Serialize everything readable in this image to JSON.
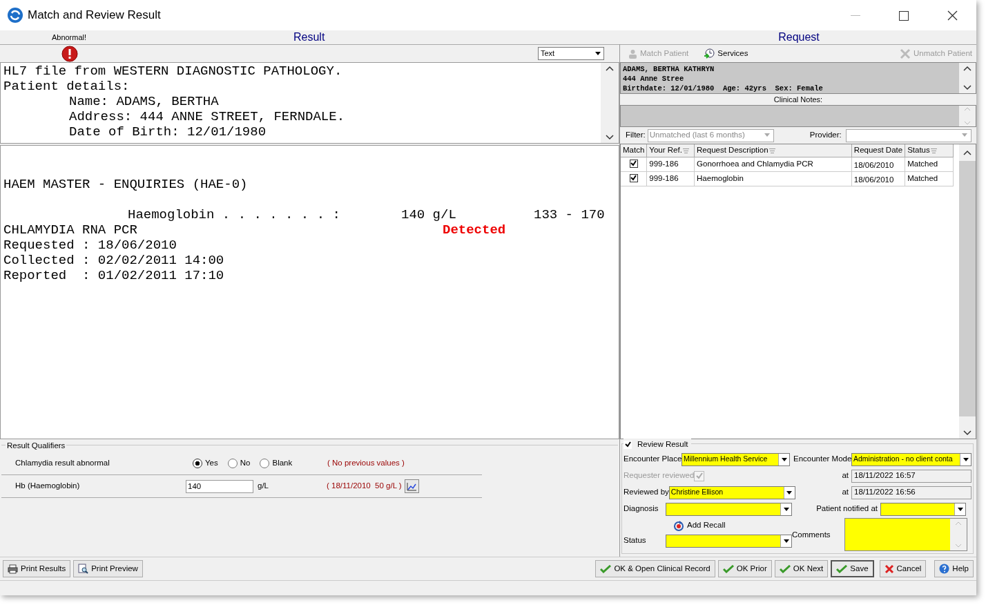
{
  "window": {
    "title": "Match and Review Result"
  },
  "result": {
    "abnormal_label": "Abnormal!",
    "heading": "Result",
    "view_select": "Text",
    "header_lines": [
      {
        "kind": "plain",
        "text": "HL7 file from WESTERN DIAGNOSTIC PATHOLOGY."
      },
      {
        "kind": "plain",
        "text": "Patient details:"
      },
      {
        "kind": "field",
        "text": "Name: ADAMS, BERTHA"
      },
      {
        "kind": "field",
        "text": "Address: 444 ANNE STREET, FERNDALE."
      },
      {
        "kind": "field",
        "text": "Date of Birth: 12/01/1980"
      }
    ],
    "report_lines": [
      {
        "kind": "title",
        "text": "HAEM MASTER - ENQUIRIES (HAE-0)"
      },
      {
        "kind": "result",
        "name": "Haemoglobin . . . . . . . :",
        "value": "140 g/L",
        "range": "133 - 170"
      },
      {
        "kind": "flagged",
        "name": "CHLAMYDIA RNA PCR",
        "value": "Detected"
      },
      {
        "kind": "plain",
        "text": "Requested : 18/06/2010"
      },
      {
        "kind": "plain",
        "text": "Collected : 02/02/2011 14:00"
      },
      {
        "kind": "plain",
        "text": "Reported  : 01/02/2011 17:10"
      }
    ]
  },
  "qualifiers": {
    "title": "Result Qualifiers",
    "rows": [
      {
        "kind": "radio",
        "label": "Chlamydia result abnormal",
        "options": [
          {
            "label": "Yes",
            "selected": true
          },
          {
            "label": "No",
            "selected": false
          },
          {
            "label": "Blank",
            "selected": false
          }
        ],
        "previous": "( No previous values )"
      },
      {
        "kind": "input",
        "label": "Hb (Haemoglobin)",
        "value": "140",
        "unit": "g/L",
        "previous": "( 18/11/2010  50 g/L )"
      }
    ]
  },
  "request": {
    "heading": "Request",
    "toolbar": [
      {
        "kind": "person",
        "label": "Match Patient",
        "disabled": true
      },
      {
        "kind": "services",
        "label": "Services",
        "disabled": false
      },
      {
        "kind": "cross",
        "label": "Unmatch Patient",
        "disabled": true
      }
    ],
    "patient_lines": [
      "ADAMS, BERTHA KATHRYN",
      "444 Anne Stree",
      "Birthdate: 12/01/1980  Age: 42yrs  Sex: Female"
    ],
    "clinical_notes_label": "Clinical Notes:",
    "filter": {
      "label": "Filter:",
      "value": "Unmatched (last 6 months)",
      "disabled": true
    },
    "provider": {
      "label": "Provider:"
    },
    "table": {
      "columns": [
        {
          "label": "Match",
          "filter_icon": false
        },
        {
          "label": "Your Ref.",
          "filter_icon": true
        },
        {
          "label": "Request Description",
          "filter_icon": true
        },
        {
          "label": "Request Date",
          "filter_icon": false
        },
        {
          "label": "Status",
          "filter_icon": true
        }
      ],
      "rows": [
        {
          "match": true,
          "ref": "999-186",
          "description": "Gonorrhoea and Chlamydia PCR",
          "date": "18/06/2010",
          "status": "Matched"
        },
        {
          "match": true,
          "ref": "999-186",
          "description": "Haemoglobin",
          "date": "18/06/2010",
          "status": "Matched"
        }
      ]
    }
  },
  "review": {
    "checked": true,
    "title": "Review Result",
    "left": [
      {
        "kind": "select",
        "label": "Encounter Place",
        "value": "Millennium Health Service"
      },
      {
        "kind": "check",
        "label": "Requester reviewed",
        "checked": true,
        "disabled": true
      },
      {
        "kind": "select",
        "label": "Reviewed by",
        "value": "Christine Ellison"
      },
      {
        "kind": "select",
        "label": "Diagnosis"
      },
      {
        "kind": "link",
        "label": "Add Recall"
      },
      {
        "kind": "select",
        "label": "Status"
      }
    ],
    "right": [
      {
        "kind": "select",
        "label": "Encounter Mode",
        "value": "Administration - no client conta"
      },
      {
        "kind": "readonly",
        "label": "at",
        "value": "18/11/2022 16:57"
      },
      {
        "kind": "readonly",
        "label": "at",
        "value": "18/11/2022 16:56"
      },
      {
        "kind": "select",
        "label": "Patient notified at"
      },
      {
        "kind": "textarea",
        "label": "Comments"
      }
    ]
  },
  "buttons_left": [
    {
      "kind": "printer",
      "label": "Print Results",
      "default": false
    },
    {
      "kind": "preview",
      "label": "Print Preview",
      "default": false
    }
  ],
  "buttons_right": [
    {
      "kind": "tick",
      "label": "OK & Open Clinical Record",
      "default": false
    },
    {
      "kind": "tick",
      "label": "OK Prior",
      "default": false
    },
    {
      "kind": "tick",
      "label": "OK Next",
      "default": false
    },
    {
      "kind": "tick",
      "label": "Save",
      "default": true
    },
    {
      "kind": "cross",
      "label": "Cancel",
      "default": false
    },
    {
      "kind": "help",
      "label": "Help",
      "default": false
    }
  ]
}
